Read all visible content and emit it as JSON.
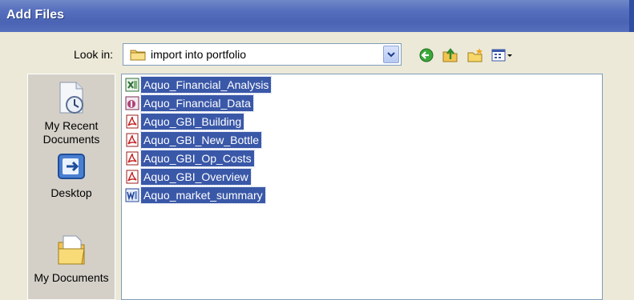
{
  "window": {
    "title": "Add Files"
  },
  "lookin": {
    "label": "Look in:",
    "value": "import into portfolio"
  },
  "toolbar": {
    "buttons": [
      "back-icon",
      "up-folder-icon",
      "new-folder-icon",
      "views-menu-icon"
    ]
  },
  "places": [
    {
      "label": "My Recent Documents",
      "icon": "recent-documents-icon"
    },
    {
      "label": "Desktop",
      "icon": "desktop-icon"
    },
    {
      "label": "My Documents",
      "icon": "my-documents-icon"
    }
  ],
  "files": [
    {
      "name": "Aquo_Financial_Analysis",
      "type": "excel"
    },
    {
      "name": "Aquo_Financial_Data",
      "type": "access"
    },
    {
      "name": "Aquo_GBI_Building",
      "type": "pdf"
    },
    {
      "name": "Aquo_GBI_New_Bottle",
      "type": "pdf"
    },
    {
      "name": "Aquo_GBI_Op_Costs",
      "type": "pdf"
    },
    {
      "name": "Aquo_GBI_Overview",
      "type": "pdf"
    },
    {
      "name": "Aquo_market_summary",
      "type": "word"
    }
  ],
  "colors": {
    "titlebar": "#4a63b3",
    "selection": "#3a58a8",
    "background": "#ece9d8"
  }
}
